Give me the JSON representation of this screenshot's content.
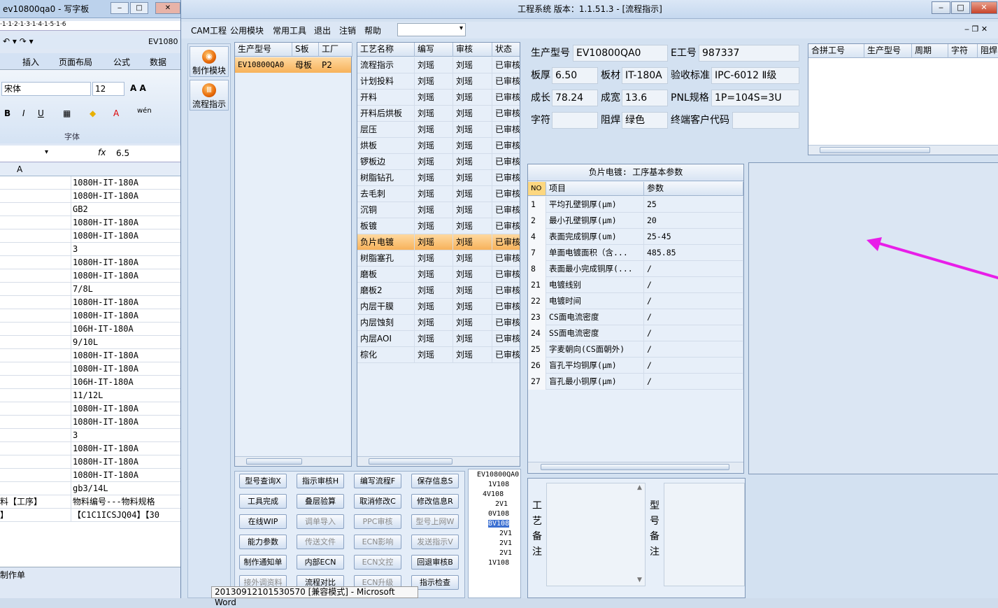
{
  "excel": {
    "title": "ev10800qa0 - 写字板",
    "title2": "EV1080",
    "tabs": [
      "插入",
      "页面布局",
      "公式",
      "数据"
    ],
    "font_name": "宋体",
    "font_size": "12",
    "font_group_label": "字体",
    "formula_value": "6.5",
    "fx_label": "fx",
    "col_a": "A",
    "rows": [
      {
        "a": "",
        "b": "1080H-IT-180A"
      },
      {
        "a": "",
        "b": "1080H-IT-180A"
      },
      {
        "a": "",
        "b": "GB2"
      },
      {
        "a": "",
        "b": "1080H-IT-180A"
      },
      {
        "a": "",
        "b": "1080H-IT-180A"
      },
      {
        "a": "",
        "b": "3"
      },
      {
        "a": "",
        "b": "1080H-IT-180A"
      },
      {
        "a": "",
        "b": "1080H-IT-180A"
      },
      {
        "a": "",
        "b": "7/8L"
      },
      {
        "a": "",
        "b": "1080H-IT-180A"
      },
      {
        "a": "",
        "b": "1080H-IT-180A"
      },
      {
        "a": "",
        "b": "106H-IT-180A"
      },
      {
        "a": "",
        "b": "9/10L"
      },
      {
        "a": "",
        "b": "1080H-IT-180A"
      },
      {
        "a": "",
        "b": "1080H-IT-180A"
      },
      {
        "a": "",
        "b": "106H-IT-180A"
      },
      {
        "a": "",
        "b": "11/12L"
      },
      {
        "a": "",
        "b": "1080H-IT-180A"
      },
      {
        "a": "",
        "b": "1080H-IT-180A"
      },
      {
        "a": "",
        "b": "3"
      },
      {
        "a": "",
        "b": "1080H-IT-180A"
      },
      {
        "a": "",
        "b": "1080H-IT-180A"
      },
      {
        "a": "",
        "b": "1080H-IT-180A"
      },
      {
        "a": "",
        "b": "gb3/14L"
      },
      {
        "a": "料【工序】",
        "b": "物料编号---物料规格"
      },
      {
        "a": "】",
        "b": "【C1C1ICSJQ04】【30"
      }
    ],
    "sheet_tab": "制作单",
    "taskbar_tip": "20130912101530570 [兼容模式] - Microsoft Word"
  },
  "app": {
    "title": "工程系统   版本：1.1.51.3 - [流程指示]",
    "menu": [
      "CAM工程",
      "公用模块",
      "常用工具",
      "退出",
      "注销",
      "帮助"
    ],
    "nav": [
      {
        "label": "制作模块",
        "icon": "produce-module-icon",
        "glyph": "◉"
      },
      {
        "label": "流程指示",
        "icon": "flow-indicator-icon",
        "glyph": "Ⅲ"
      }
    ],
    "model_table": {
      "headers": [
        "生产型号",
        "S板",
        "工厂"
      ],
      "rows": [
        [
          "EV10800QA0",
          "母板",
          "P2"
        ]
      ]
    },
    "process_table": {
      "headers": [
        "工艺名称",
        "编写",
        "审核",
        "状态"
      ],
      "rows": [
        [
          "流程指示",
          "刘瑶",
          "刘瑶",
          "已审核"
        ],
        [
          "计划投料",
          "刘瑶",
          "刘瑶",
          "已审核"
        ],
        [
          "开料",
          "刘瑶",
          "刘瑶",
          "已审核"
        ],
        [
          "开料后烘板",
          "刘瑶",
          "刘瑶",
          "已审核"
        ],
        [
          "层压",
          "刘瑶",
          "刘瑶",
          "已审核"
        ],
        [
          "烘板",
          "刘瑶",
          "刘瑶",
          "已审核"
        ],
        [
          "锣板边",
          "刘瑶",
          "刘瑶",
          "已审核"
        ],
        [
          "树脂钻孔",
          "刘瑶",
          "刘瑶",
          "已审核"
        ],
        [
          "去毛刺",
          "刘瑶",
          "刘瑶",
          "已审核"
        ],
        [
          "沉铜",
          "刘瑶",
          "刘瑶",
          "已审核"
        ],
        [
          "板镀",
          "刘瑶",
          "刘瑶",
          "已审核"
        ],
        [
          "负片电镀",
          "刘瑶",
          "刘瑶",
          "已审核"
        ],
        [
          "树脂塞孔",
          "刘瑶",
          "刘瑶",
          "已审核"
        ],
        [
          "磨板",
          "刘瑶",
          "刘瑶",
          "已审核"
        ],
        [
          "磨板2",
          "刘瑶",
          "刘瑶",
          "已审核"
        ],
        [
          "内层干膜",
          "刘瑶",
          "刘瑶",
          "已审核"
        ],
        [
          "内层蚀刻",
          "刘瑶",
          "刘瑶",
          "已审核"
        ],
        [
          "内层AOI",
          "刘瑶",
          "刘瑶",
          "已审核"
        ],
        [
          "棕化",
          "刘瑶",
          "刘瑶",
          "已审核"
        ]
      ],
      "selected_index": 11
    },
    "info": {
      "fields": [
        {
          "label": "生产型号",
          "value": "EV10800QA0"
        },
        {
          "label": "E工号",
          "value": "987337"
        },
        {
          "label": "板厚",
          "value": "6.50"
        },
        {
          "label": "板材",
          "value": "IT-180A"
        },
        {
          "label": "验收标准",
          "value": "IPC-6012 Ⅱ级"
        },
        {
          "label": "成长",
          "value": "78.24"
        },
        {
          "label": "成宽",
          "value": "13.6"
        },
        {
          "label": "PNL规格",
          "value": "1P=104S=3U"
        },
        {
          "label": "字符",
          "value": ""
        },
        {
          "label": "阻焊",
          "value": "绿色"
        },
        {
          "label": "终端客户代码",
          "value": ""
        }
      ]
    },
    "merge_table": {
      "headers": [
        "合拼工号",
        "生产型号",
        "周期",
        "字符",
        "阻焊"
      ]
    },
    "param_panel": {
      "title": "负片电镀: 工序基本参数",
      "headers": [
        "NO",
        "项目",
        "参数"
      ],
      "rows": [
        [
          "1",
          "平均孔壁铜厚(μm)",
          "25"
        ],
        [
          "2",
          "最小孔壁铜厚(μm)",
          "20"
        ],
        [
          "4",
          "表面完成铜厚(um)",
          "25-45"
        ],
        [
          "7",
          "单面电镀面积（含...",
          "485.85"
        ],
        [
          "8",
          "表面最小完成铜厚(...",
          "/"
        ],
        [
          "21",
          "电镀线别",
          "/"
        ],
        [
          "22",
          "电镀时间",
          "/"
        ],
        [
          "23",
          "CS面电流密度",
          "/"
        ],
        [
          "24",
          "SS面电流密度",
          "/"
        ],
        [
          "25",
          "字麦朝向(CS面朝外)",
          "/"
        ],
        [
          "26",
          "盲孔平均铜厚(μm)",
          "/"
        ],
        [
          "27",
          "盲孔最小铜厚(μm)",
          "/"
        ]
      ]
    },
    "buttons": [
      [
        {
          "t": "型号查询X",
          "d": false
        },
        {
          "t": "指示审核H",
          "d": false
        },
        {
          "t": "编写流程F",
          "d": false
        },
        {
          "t": "保存信息S",
          "d": false
        }
      ],
      [
        {
          "t": "工具完成",
          "d": false
        },
        {
          "t": "叠层验算",
          "d": false
        },
        {
          "t": "取消修改C",
          "d": false
        },
        {
          "t": "修改信息R",
          "d": false
        }
      ],
      [
        {
          "t": "在线WIP",
          "d": false
        },
        {
          "t": "调单导入",
          "d": true
        },
        {
          "t": "PPC审核",
          "d": true
        },
        {
          "t": "型号上网W",
          "d": true
        }
      ],
      [
        {
          "t": "能力参数",
          "d": false
        },
        {
          "t": "传送文件",
          "d": true
        },
        {
          "t": "ECN影响",
          "d": true
        },
        {
          "t": "发送指示V",
          "d": true
        }
      ],
      [
        {
          "t": "制作通知单",
          "d": false
        },
        {
          "t": "内部ECN",
          "d": false
        },
        {
          "t": "ECN文控",
          "d": true
        },
        {
          "t": "回退审核B",
          "d": false
        }
      ],
      [
        {
          "t": "接外调资料",
          "d": true
        },
        {
          "t": "流程对比",
          "d": false
        },
        {
          "t": "ECN升级",
          "d": true
        },
        {
          "t": "指示检查",
          "d": false
        }
      ]
    ],
    "tree": [
      "EV10800QA0",
      "1V108",
      "4V108",
      "2V1",
      "0V108",
      "8V108",
      "2V1",
      "2V1",
      "2V1",
      "1V108"
    ],
    "remarks": {
      "process_label": "工艺备注",
      "model_label": "型号备注"
    },
    "annotation_color": "#e81ee8"
  }
}
